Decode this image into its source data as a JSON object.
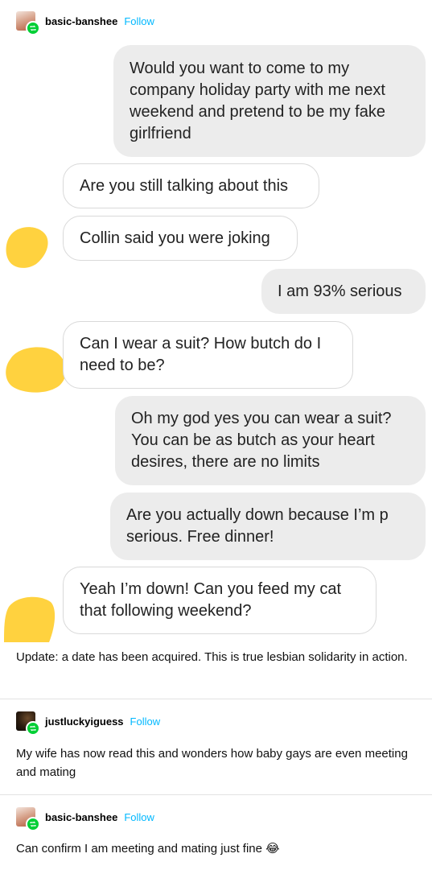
{
  "post": {
    "author": "basic-banshee",
    "follow_label": "Follow",
    "messages": [
      {
        "side": "sent",
        "text": "Would you want to come to my company holiday party with me next weekend and pretend to be my fake girlfriend"
      },
      {
        "side": "recv",
        "text": "Are you still talking about this"
      },
      {
        "side": "recv",
        "text": "Collin said you were joking"
      },
      {
        "side": "sent",
        "text": "I am 93% serious"
      },
      {
        "side": "recv",
        "text": "Can I wear a suit? How butch do I need to be?"
      },
      {
        "side": "sent",
        "text": "Oh my god yes you can wear a suit? You can be as butch as your heart desires, there are no limits"
      },
      {
        "side": "sent",
        "text": "Are you actually down because I’m p serious. Free dinner!"
      },
      {
        "side": "recv",
        "text": "Yeah I’m down! Can you feed my cat that following weekend?"
      }
    ],
    "caption": "Update: a date has been acquired. This is true lesbian solidarity in action."
  },
  "reblog1": {
    "author": "justluckyiguess",
    "follow_label": "Follow",
    "text": "My wife has now read this and wonders how baby gays are even meeting and mating"
  },
  "reblog2": {
    "author": "basic-banshee",
    "follow_label": "Follow",
    "text": "Can confirm I am meeting and mating just fine 😂"
  },
  "colors": {
    "follow": "#00b8ff",
    "reblog_badge": "#00cf35",
    "sent_bubble": "#ececec",
    "censor_blob": "#ffd23f"
  },
  "icons": [
    "avatar",
    "reblog-icon",
    "censor-blob"
  ]
}
